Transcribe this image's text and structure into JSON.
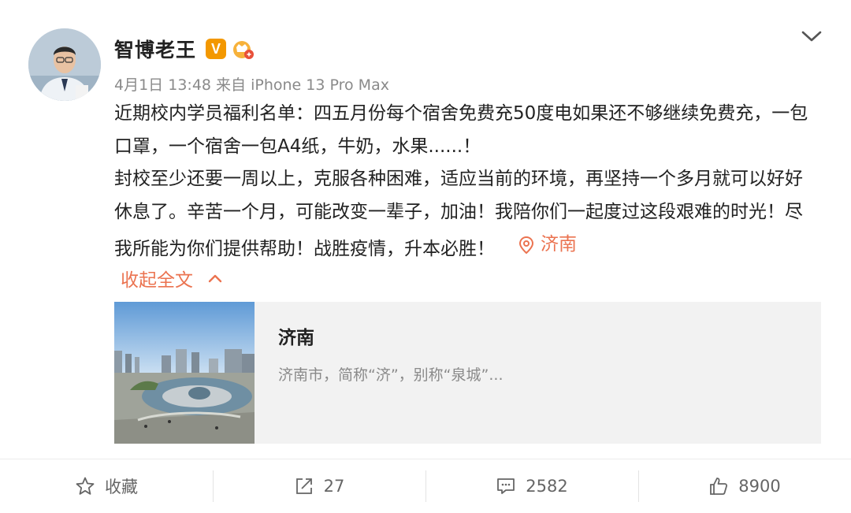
{
  "user": {
    "name": "智博老王",
    "verified_badge": "V",
    "verified_color": "#f39800"
  },
  "meta": {
    "date": "4月1日",
    "time": "13:48",
    "from_label": "来自",
    "device": "iPhone 13 Pro Max"
  },
  "post": {
    "paragraph1": "近期校内学员福利名单：四五月份每个宿舍免费充50度电如果还不够继续免费充，一包口罩，一个宿舍一包A4纸，牛奶，水果......！",
    "paragraph2": "封校至少还要一周以上，克服各种困难，适应当前的环境，再坚持一个多月就可以好好休息了。辛苦一个月，可能改变一辈子，加油！我陪你们一起度过这段艰难的时光！尽我所能为你们提供帮助！战胜疫情，升本必胜！",
    "location_tag": "济南",
    "collapse_label": "收起全文"
  },
  "location_card": {
    "title": "济南",
    "description": "济南市，简称“济”，别称“泉城”..."
  },
  "actions": {
    "favorite_label": "收藏",
    "repost_count": "27",
    "comment_count": "2582",
    "like_count": "8900"
  },
  "colors": {
    "accent": "#eb7350",
    "text": "#222222",
    "muted": "#8a8a8a"
  }
}
